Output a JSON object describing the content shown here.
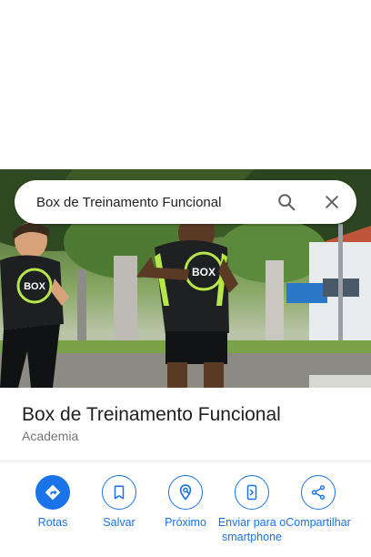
{
  "search": {
    "query": "Box de Treinamento Funcional"
  },
  "place": {
    "name": "Box de Treinamento Funcional",
    "category": "Academia",
    "photo_logo_text": "BOX"
  },
  "actions": [
    {
      "label": "Rotas",
      "icon": "directions-icon"
    },
    {
      "label": "Salvar",
      "icon": "bookmark-icon"
    },
    {
      "label": "Próximo",
      "icon": "nearby-icon"
    },
    {
      "label": "Enviar para o smartphone",
      "icon": "send-to-phone-icon"
    },
    {
      "label": "Compartilhar",
      "icon": "share-icon"
    }
  ],
  "colors": {
    "accent": "#1a73e8",
    "title": "#202124",
    "secondary": "#70757a",
    "divider": "#e8eaed"
  }
}
